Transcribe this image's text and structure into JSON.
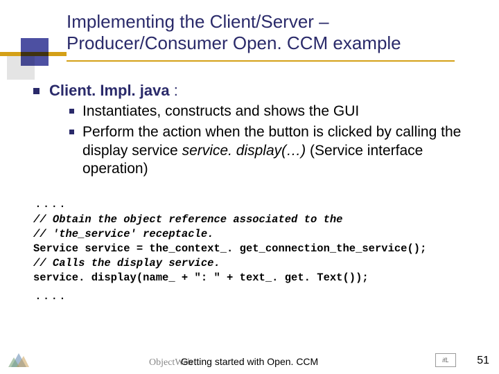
{
  "title_line1": "Implementing the Client/Server –",
  "title_line2": "Producer/Consumer Open. CCM example",
  "bullets": {
    "lvl1_label": "Client. Impl. java",
    "lvl1_suffix": " :",
    "lvl2a": "Instantiates, constructs and shows the GUI",
    "lvl2b_part1": "Perform the action when the button is clicked by calling the display service ",
    "lvl2b_italic": "service. display(…) ",
    "lvl2b_part2": "(Service interface operation)"
  },
  "ellipsis_top": ". . . .",
  "code": {
    "l1": "// Obtain the object reference associated to the",
    "l2": "// 'the_service' receptacle.",
    "l3": "Service service = the_context_. get_connection_the_service();",
    "l4": "// Calls the display service.",
    "l5": "service. display(name_ + \": \" + text_. get. Text());"
  },
  "ellipsis_bottom": ". . . .",
  "footer": {
    "center": "Getting started with Open. CCM",
    "page": "51",
    "ow_logo_text": "ObjectWeb",
    "right_logo_text": "ifL"
  }
}
